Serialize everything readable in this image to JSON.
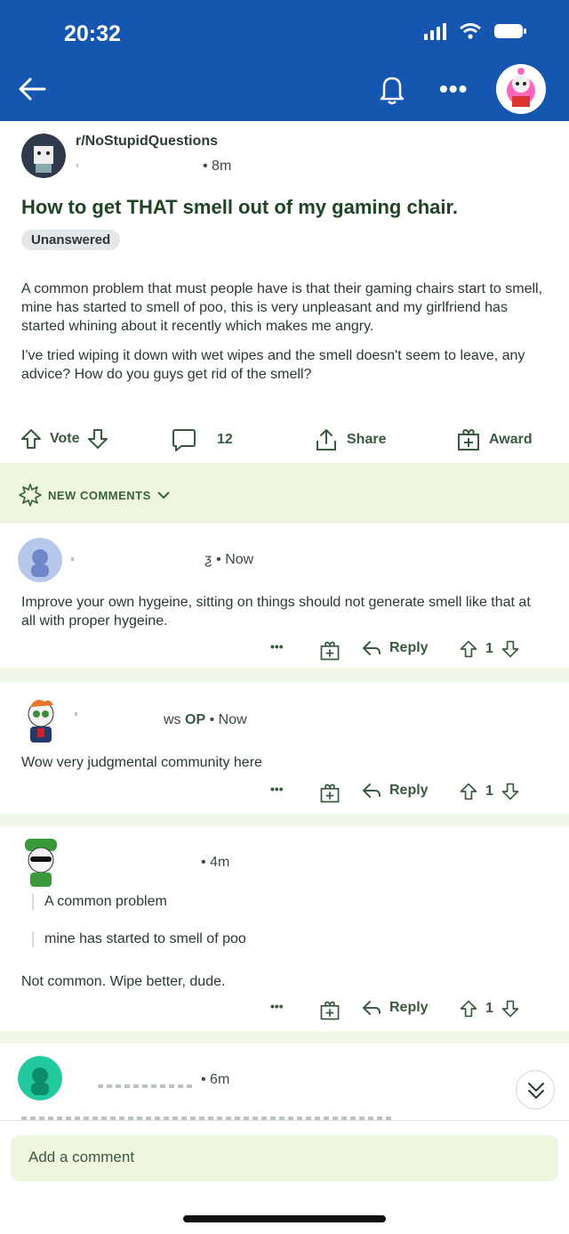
{
  "status_bar": {
    "time": "20:32"
  },
  "colors": {
    "header": "#1456b0",
    "accent_green": "#3a5a40",
    "new_comments_bg": "#eef6e0"
  },
  "post": {
    "subreddit": "r/NoStupidQuestions",
    "time": "• 8m",
    "title": "How to get THAT smell out of my gaming chair.",
    "flair": "Unanswered",
    "body_p1": "A common problem that must people have is that their gaming chairs start to smell, mine has started to smell of poo, this is very unpleasant and my girlfriend has started whining about it recently which makes me angry.",
    "body_p2": "I've tried wiping it down with wet wipes and the smell doesn't seem to leave, any advice? How do you guys get rid of the smell?",
    "vote_label": "Vote",
    "comment_count": "12",
    "share_label": "Share",
    "award_label": "Award"
  },
  "new_comments": {
    "label": "NEW COMMENTS"
  },
  "comments": [
    {
      "meta_prefix": "ƺ",
      "meta_time": "• Now",
      "text": "Improve your own hygeine, sitting on things should not generate smell like that at all with proper hygeine.",
      "more": "•••",
      "reply_label": "Reply",
      "votes": "1"
    },
    {
      "meta_prefix": "ws",
      "op_label": "OP",
      "meta_time": "• Now",
      "text": "Wow very judgmental community here",
      "more": "•••",
      "reply_label": "Reply",
      "votes": "1"
    },
    {
      "meta_time": "• 4m",
      "quote1": "A common problem",
      "quote2": "mine has started to smell of poo",
      "text": "Not common. Wipe better, dude.",
      "more": "•••",
      "reply_label": "Reply",
      "votes": "1"
    },
    {
      "meta_time": "• 6m"
    }
  ],
  "composer": {
    "placeholder": "Add a comment"
  },
  "icons": [
    "back-arrow-icon",
    "bell-icon",
    "more-icon",
    "upvote-icon",
    "downvote-icon",
    "comment-icon",
    "share-icon",
    "award-icon",
    "reply-icon",
    "chevron-down-icon",
    "sparkle-icon"
  ]
}
